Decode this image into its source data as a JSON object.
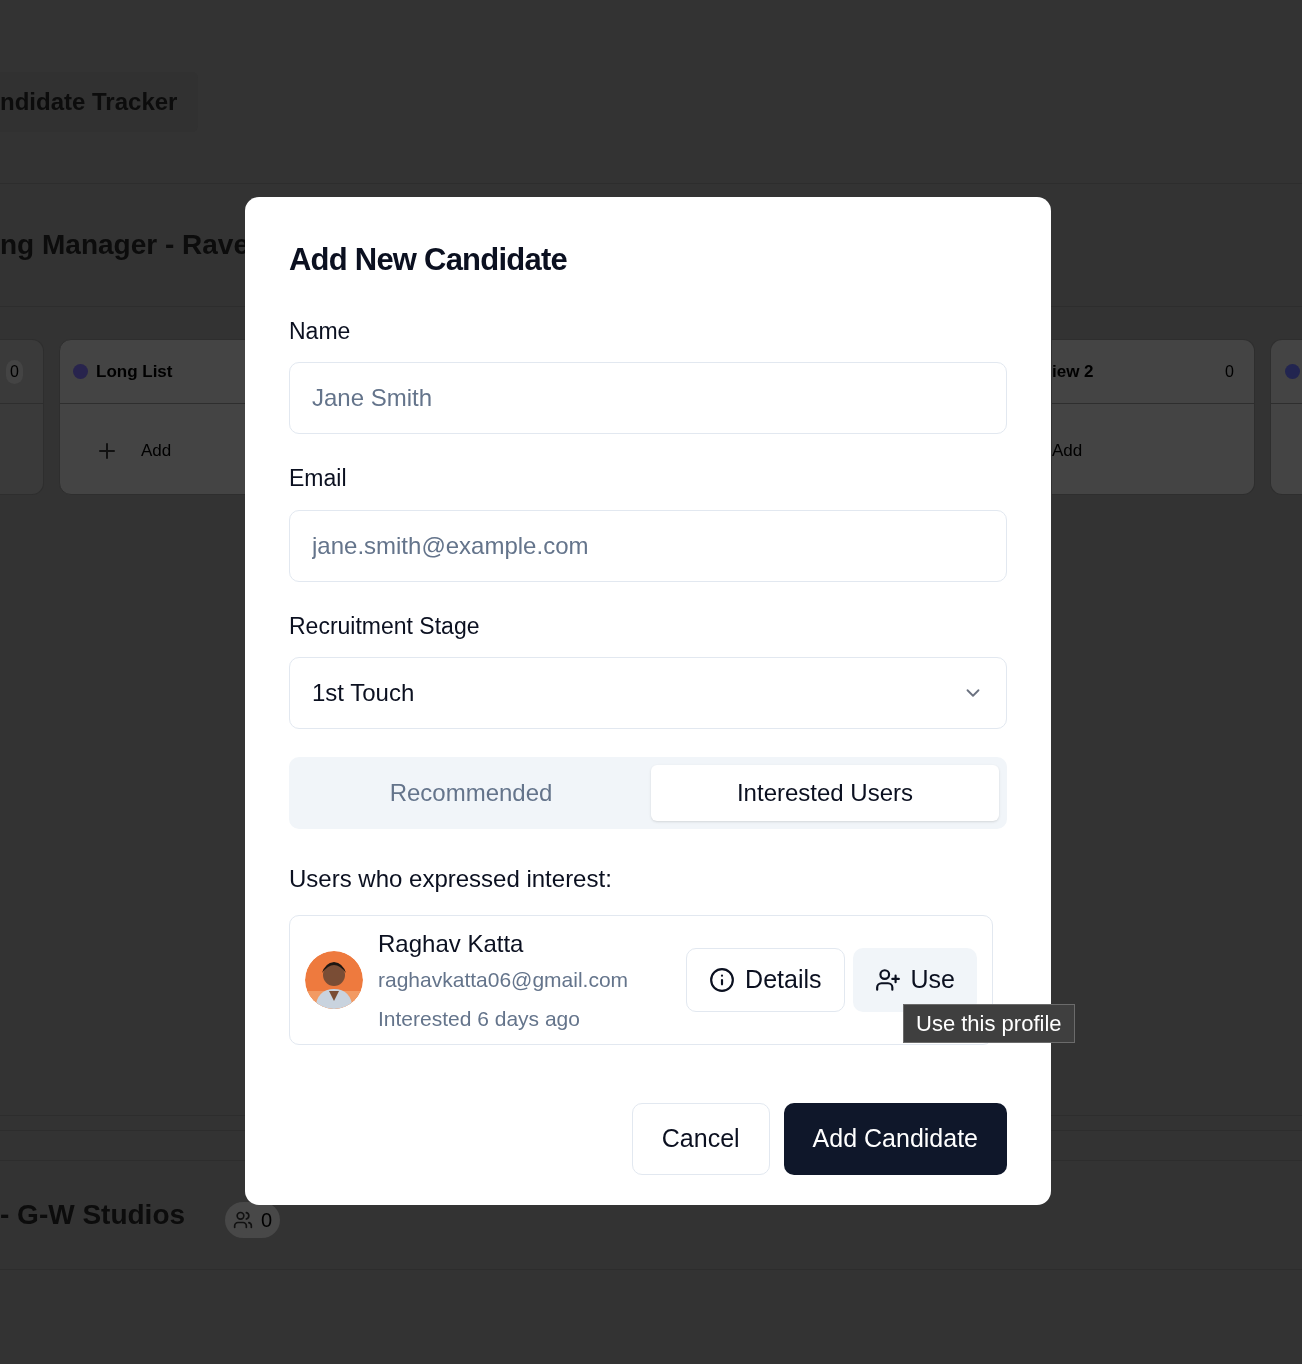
{
  "background": {
    "app_title": "ndidate Tracker",
    "job_title": "ng Manager - Rave",
    "left_columns": [
      {
        "count": "0"
      },
      {
        "name": "Long List",
        "color": "#28244d",
        "add_label": "Add"
      }
    ],
    "right_columns": [
      {
        "name": "iew 2",
        "count": "0",
        "add_label": "Add"
      },
      {
        "color": "#222550"
      }
    ],
    "next_job": {
      "title": "- G-W Studios",
      "count": "0"
    }
  },
  "dialog": {
    "title": "Add New Candidate",
    "fields": [
      {
        "kind": "text",
        "label": "Name",
        "placeholder": "Jane Smith"
      },
      {
        "kind": "text",
        "label": "Email",
        "placeholder": "jane.smith@example.com"
      },
      {
        "kind": "select",
        "label": "Recruitment Stage",
        "value": "1st Touch"
      }
    ],
    "tabs": [
      {
        "label": "Recommended",
        "selected": false
      },
      {
        "label": "Interested Users",
        "selected": true
      }
    ],
    "list_heading": "Users who expressed interest:",
    "users": [
      {
        "name": "Raghav Katta",
        "email": "raghavkatta06@gmail.com",
        "meta": "Interested 6 days ago",
        "details_label": "Details",
        "use_label": "Use"
      }
    ],
    "tooltip": "Use this profile",
    "buttons": [
      {
        "kind": "outline",
        "label": "Cancel"
      },
      {
        "kind": "primary",
        "label": "Add Candidate"
      }
    ]
  }
}
